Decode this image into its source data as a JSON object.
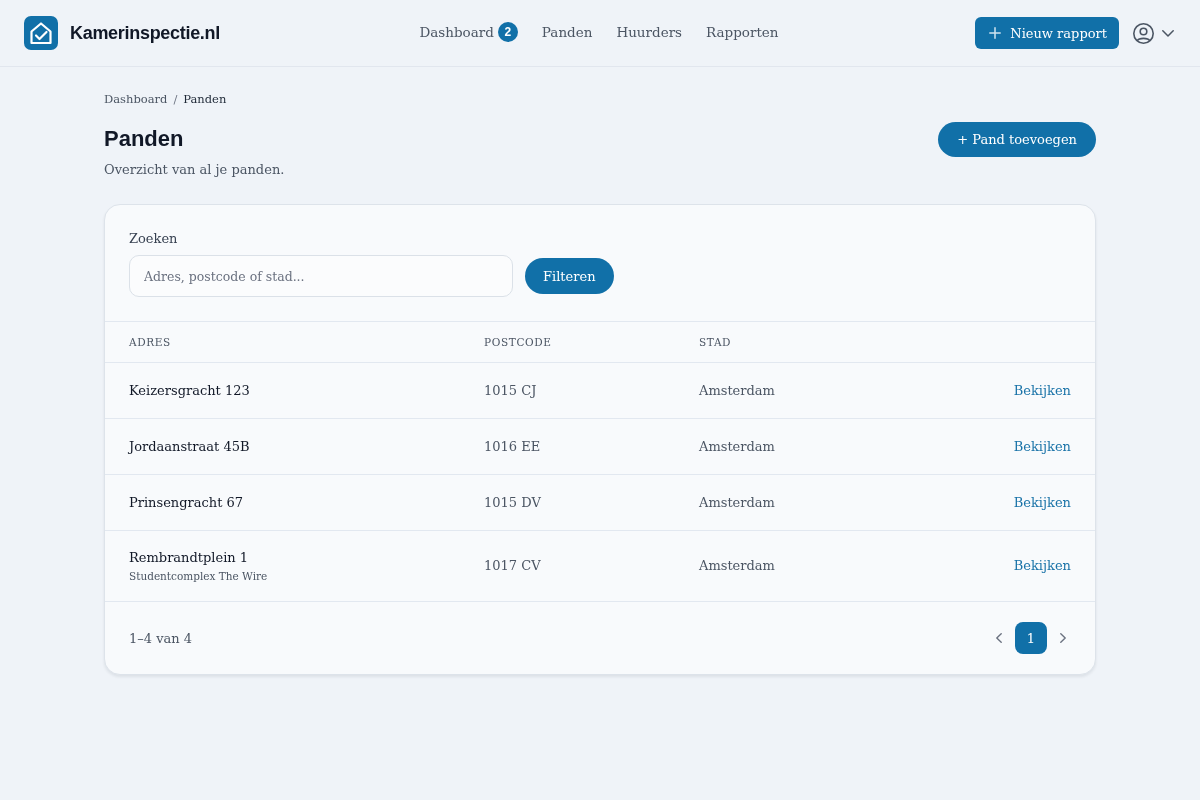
{
  "header": {
    "brand": "Kamerinspectie.nl",
    "nav": [
      {
        "label": "Dashboard",
        "badge": "2",
        "selected": false
      },
      {
        "label": "Panden",
        "selected": false
      },
      {
        "label": "Huurders",
        "selected": false
      },
      {
        "label": "Rapporten",
        "selected": false
      }
    ],
    "primary_button": "Nieuw rapport"
  },
  "breadcrumb": {
    "items": [
      "Dashboard",
      "Panden"
    ],
    "separator": "/"
  },
  "page": {
    "title": "Panden",
    "subtitle": "Overzicht van al je panden.",
    "add_button": "+ Pand toevoegen"
  },
  "search": {
    "label": "Zoeken",
    "placeholder": "Adres, postcode of stad...",
    "button": "Filteren"
  },
  "table": {
    "columns": [
      "ADRES",
      "POSTCODE",
      "STAD"
    ],
    "rows": [
      {
        "address": "Keizersgracht 123",
        "postcode": "1015 CJ",
        "city": "Amsterdam",
        "action": "Bekijken"
      },
      {
        "address": "Jordaanstraat 45B",
        "postcode": "1016 EE",
        "city": "Amsterdam",
        "action": "Bekijken"
      },
      {
        "address": "Prinsengracht 67",
        "postcode": "1015 DV",
        "city": "Amsterdam",
        "action": "Bekijken"
      },
      {
        "address": "Rembrandtplein 1",
        "note": "Studentcomplex The Wire",
        "postcode": "1017 CV",
        "city": "Amsterdam",
        "action": "Bekijken"
      }
    ]
  },
  "footer": {
    "range": "1–4 van 4",
    "pages": [
      {
        "label": "1",
        "selected": true
      }
    ]
  }
}
